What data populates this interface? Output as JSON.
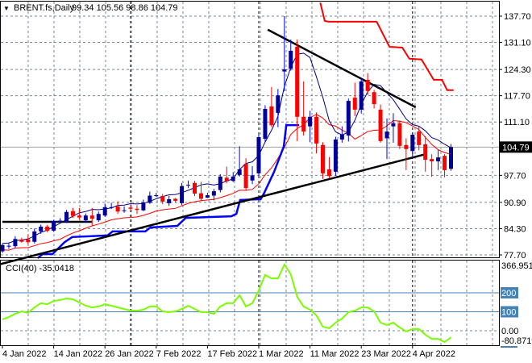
{
  "header": {
    "menu_icon": "triangle-down-icon",
    "symbol": "BRENT.fs,Daily",
    "ohlc": "99.34 105.56 98.86 104.79"
  },
  "indicator": {
    "label": "CCI(40) -35.0418"
  },
  "colors": {
    "bull": "#000099",
    "bear": "#ff0000",
    "ma_fast": "#000080",
    "ma_slow": "#ff0000",
    "stop_low": "#0000ff",
    "stop_high": "#ff0000",
    "trendline": "#000000",
    "cci": "#7cfc00",
    "cci_levels": "#4682b4",
    "grid": "#778899"
  },
  "chart_data": [
    {
      "type": "candlestick",
      "title": "BRENT.fs,Daily",
      "price_axis": {
        "ticks": [
          "137.70",
          "131.10",
          "124.30",
          "117.70",
          "111.10",
          "97.70",
          "90.90",
          "84.30",
          "77.70"
        ],
        "ylim": [
          77.7,
          137.7
        ],
        "current_price": "104.79"
      },
      "time_axis": {
        "labels": [
          {
            "index": 0,
            "text": "4 Jan 2022"
          },
          {
            "index": 8,
            "text": "14 Jan 2022"
          },
          {
            "index": 16,
            "text": "26 Jan 2022"
          },
          {
            "index": 24,
            "text": "7 Feb 2022"
          },
          {
            "index": 32,
            "text": "17 Feb 2022"
          },
          {
            "index": 40,
            "text": "1 Mar 2022"
          },
          {
            "index": 48,
            "text": "11 Mar 2022"
          },
          {
            "index": 56,
            "text": "23 Mar 2022"
          },
          {
            "index": 64,
            "text": "4 Apr 2022"
          }
        ],
        "period_separators": [
          20,
          40,
          64
        ]
      },
      "candles_ohlc": [
        [
          78.6,
          80.6,
          78.2,
          80.2
        ],
        [
          79.8,
          80.8,
          79.2,
          80.0
        ],
        [
          79.9,
          82.4,
          79.4,
          81.7
        ],
        [
          81.5,
          82.0,
          80.8,
          81.0
        ],
        [
          81.6,
          82.8,
          80.3,
          80.9
        ],
        [
          81.0,
          84.3,
          80.6,
          83.6
        ],
        [
          83.6,
          85.3,
          83.0,
          84.8
        ],
        [
          84.8,
          85.2,
          83.4,
          83.8
        ],
        [
          83.8,
          86.5,
          83.5,
          86.2
        ],
        [
          86.1,
          86.9,
          85.8,
          86.3
        ],
        [
          86.0,
          89.0,
          85.7,
          88.5
        ],
        [
          88.7,
          89.5,
          87.0,
          87.5
        ],
        [
          87.6,
          89.5,
          86.5,
          87.1
        ],
        [
          86.4,
          88.1,
          85.9,
          87.6
        ],
        [
          87.6,
          89.5,
          85.0,
          86.8
        ],
        [
          86.4,
          88.6,
          86.0,
          88.0
        ],
        [
          87.6,
          90.6,
          87.3,
          89.7
        ],
        [
          89.6,
          90.8,
          89.2,
          89.7
        ],
        [
          89.9,
          91.2,
          88.0,
          88.6
        ],
        [
          88.8,
          89.9,
          88.3,
          88.9
        ],
        [
          89.6,
          90.4,
          88.9,
          89.3
        ],
        [
          89.3,
          90.2,
          88.0,
          89.0
        ],
        [
          88.9,
          91.6,
          88.7,
          90.9
        ],
        [
          90.8,
          93.6,
          90.5,
          92.6
        ],
        [
          92.6,
          93.3,
          92.3,
          92.7
        ],
        [
          92.5,
          93.0,
          90.4,
          91.1
        ],
        [
          90.7,
          92.5,
          90.0,
          91.7
        ],
        [
          91.8,
          92.0,
          90.8,
          91.3
        ],
        [
          90.7,
          95.8,
          90.2,
          95.0
        ],
        [
          95.2,
          96.4,
          94.5,
          95.3
        ],
        [
          95.8,
          96.3,
          92.5,
          93.1
        ],
        [
          93.2,
          96.0,
          91.4,
          91.8
        ],
        [
          92.1,
          93.3,
          92.0,
          92.7
        ],
        [
          92.6,
          94.3,
          91.4,
          93.7
        ],
        [
          94.0,
          98.0,
          93.4,
          97.4
        ],
        [
          97.1,
          99.9,
          95.7,
          96.2
        ],
        [
          96.3,
          98.5,
          96.0,
          97.4
        ],
        [
          97.8,
          105.0,
          97.4,
          99.2
        ],
        [
          100.6,
          102.0,
          94.0,
          94.5
        ],
        [
          96.4,
          100.0,
          95.5,
          97.7
        ],
        [
          98.2,
          108.0,
          97.5,
          107.3
        ],
        [
          106.9,
          115.3,
          106.0,
          114.4
        ],
        [
          115.0,
          119.9,
          109.8,
          110.3
        ],
        [
          113.4,
          119.4,
          109.8,
          117.8
        ],
        [
          123.8,
          137.7,
          118.8,
          124.3
        ],
        [
          124.5,
          131.8,
          124.0,
          129.0
        ],
        [
          130.0,
          131.8,
          106.3,
          112.4
        ],
        [
          112.4,
          121.3,
          107.7,
          108.7
        ],
        [
          110.0,
          113.9,
          106.0,
          112.4
        ],
        [
          112.4,
          113.5,
          103.2,
          105.7
        ],
        [
          105.3,
          106.0,
          96.8,
          98.2
        ],
        [
          99.2,
          102.3,
          97.0,
          97.5
        ],
        [
          98.6,
          107.4,
          97.6,
          106.7
        ],
        [
          106.7,
          110.0,
          105.9,
          107.9
        ],
        [
          107.7,
          117.0,
          106.2,
          116.4
        ],
        [
          117.2,
          121.0,
          112.6,
          114.2
        ],
        [
          114.2,
          122.1,
          113.2,
          121.3
        ],
        [
          121.7,
          123.4,
          117.9,
          118.9
        ],
        [
          118.6,
          119.2,
          114.5,
          115.6
        ],
        [
          114.2,
          115.5,
          105.9,
          106.3
        ],
        [
          107.0,
          112.0,
          101.8,
          108.7
        ],
        [
          110.0,
          113.3,
          105.9,
          110.8
        ],
        [
          110.8,
          111.5,
          104.3,
          105.1
        ],
        [
          105.3,
          107.0,
          99.0,
          104.3
        ],
        [
          103.8,
          108.4,
          102.0,
          107.9
        ],
        [
          108.7,
          110.0,
          104.0,
          105.3
        ],
        [
          105.5,
          107.5,
          98.6,
          101.6
        ],
        [
          101.8,
          103.0,
          97.3,
          101.2
        ],
        [
          101.2,
          104.0,
          99.0,
          102.2
        ],
        [
          102.6,
          103.0,
          97.2,
          99.0
        ],
        [
          99.34,
          105.56,
          98.86,
          104.79
        ]
      ],
      "overlays": {
        "stop_low_line": [
          [
            5.5,
            76.9
          ],
          [
            6.3,
            77.9
          ],
          [
            7.8,
            77.9
          ],
          [
            9.7,
            80.9
          ],
          [
            10.9,
            82.2
          ],
          [
            16.4,
            82.6
          ],
          [
            17.2,
            83.6
          ],
          [
            22.3,
            83.6
          ],
          [
            23.1,
            84.6
          ],
          [
            27.3,
            85.0
          ],
          [
            28.6,
            87.0
          ],
          [
            35.7,
            87.4
          ],
          [
            36.5,
            88.0
          ],
          [
            37.1,
            91.5
          ],
          [
            40.3,
            91.7
          ],
          [
            40.8,
            93.1
          ],
          [
            42.4,
            98.6
          ],
          [
            43.9,
            104.9
          ],
          [
            44.3,
            110.3
          ],
          [
            46.3,
            110.3
          ]
        ],
        "stop_high_line": [
          [
            49.6,
            141.1
          ],
          [
            50.3,
            136.5
          ],
          [
            50.9,
            136.3
          ],
          [
            58.4,
            136.3
          ],
          [
            60.4,
            130.0
          ],
          [
            62.4,
            129.8
          ],
          [
            63.5,
            127.0
          ],
          [
            65.4,
            126.8
          ],
          [
            67.3,
            121.7
          ],
          [
            68.6,
            121.7
          ],
          [
            69.4,
            119.1
          ],
          [
            70.4,
            119.1
          ]
        ],
        "trendlines": [
          [
            [
              0,
              86.0
            ],
            [
              14,
              86.0
            ]
          ],
          [
            [
              -0.5,
              75.3
            ],
            [
              66,
              103.0
            ]
          ],
          [
            [
              41.4,
              134.3
            ],
            [
              64.5,
              114.8
            ]
          ]
        ]
      }
    },
    {
      "type": "line",
      "title": "CCI(40)",
      "value": "-35.0418",
      "yaxis": {
        "max_label": "366.9512",
        "min_label": "-80.8719",
        "zero_label": "0.00",
        "levels": [
          "200",
          "100"
        ]
      },
      "ylim": [
        -80.8719,
        366.9512
      ],
      "values": [
        60,
        72,
        89,
        102,
        94,
        123,
        145,
        140,
        157,
        162,
        170,
        166,
        149,
        132,
        123,
        128,
        140,
        132,
        123,
        115,
        106,
        106,
        111,
        128,
        128,
        102,
        98,
        102,
        115,
        132,
        115,
        98,
        98,
        89,
        128,
        145,
        145,
        187,
        128,
        145,
        213,
        294,
        276,
        276,
        349,
        298,
        179,
        128,
        111,
        81,
        21,
        13,
        43,
        64,
        98,
        106,
        123,
        123,
        102,
        43,
        30,
        43,
        17,
        -4,
        9,
        9,
        -21,
        -43,
        -43,
        -60,
        -35
      ]
    }
  ]
}
